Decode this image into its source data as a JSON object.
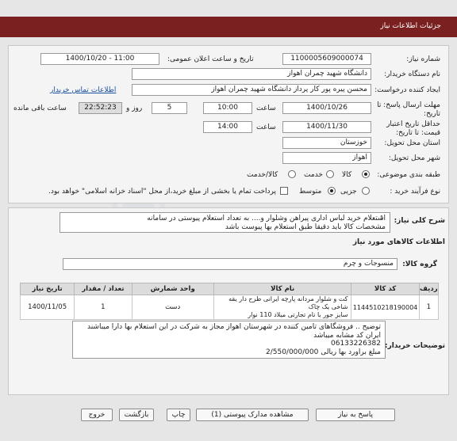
{
  "header": {
    "title": "جزئیات اطلاعات نیاز"
  },
  "form": {
    "need_number_label": "شماره نیاز:",
    "need_number": "1100005609000074",
    "announce_label": "تاریخ و ساعت اعلان عمومی:",
    "announce_value": "1400/10/20 - 11:00",
    "buyer_org_label": "نام دستگاه خریدار:",
    "buyer_org": "دانشگاه شهید چمران اهواز",
    "creator_label": "ایجاد کننده درخواست:",
    "creator": "محسن پیره پور کار پرداز دانشگاه شهید چمران اهواز",
    "contact_link": "اطلاعات تماس خریدار",
    "deadline_label": "مهلت ارسال پاسخ: تا تاریخ:",
    "deadline_date": "1400/10/26",
    "time_label": "ساعت",
    "deadline_time": "10:00",
    "days_value": "5",
    "days_label": "روز و",
    "remaining_time": "22:52:23",
    "remaining_label": "ساعت باقی مانده",
    "validity_label": "حداقل تاریخ اعتبار قیمت: تا تاریخ:",
    "validity_date": "1400/11/30",
    "validity_time": "14:00",
    "province_label": "استان محل تحویل:",
    "province": "خوزستان",
    "city_label": "شهر محل تحویل:",
    "city": "اهواز",
    "category_label": "طبقه بندی موضوعی:",
    "category_options": [
      "کالا",
      "خدمت",
      "کالا/خدمت"
    ],
    "process_label": "نوع فرآیند خرید :",
    "process_options": [
      "جزیی",
      "متوسط"
    ],
    "payment_note": "پرداخت تمام یا بخشی از مبلغ خرید،از محل \"اسناد خزانه اسلامی\" خواهد بود."
  },
  "details": {
    "general_label": "شرح کلی نیاز:",
    "general_text_1": "استعلام خرید لباس اداری پیراهن وشلوار و.... به تعداد استعلام پیوستی در سامانه",
    "general_text_2": "مشخصات کالا باید دقیقا طبق استعلام بها پیوست باشد",
    "goods_info_title": "اطلاعات کالاهای مورد نیاز",
    "goods_group_label": "گروه کالا:",
    "goods_group": "منسوجات و چرم",
    "table_headers": [
      "ردیف",
      "کد کالا",
      "نام کالا",
      "واحد شمارش",
      "تعداد / مقدار",
      "تاریخ نیاز"
    ],
    "rows": [
      {
        "row": "1",
        "code": "1144510218190004",
        "name_1": "کت و شلوار مردانه پارچه ایرانی طرح دار یقه شاخی یک چاک",
        "name_2": "سایز جور با نام تجارتی میلاد 110 نوار",
        "unit": "دست",
        "qty": "1",
        "date": "1400/11/05"
      }
    ],
    "buyer_notes_label": "توضیحات خریدار:",
    "notes_line_1": "توضیح .. فروشگاهای تامین کننده در شهرستان اهواز مجاز به شرکت در این استعلام بها دارا میباشند",
    "notes_line_2": "ایران کد مشابه میباشد",
    "notes_line_3": "06133226382",
    "notes_line_4": "مبلغ براورد بها  ریالی  2/550/000/000"
  },
  "buttons": {
    "reply": "پاسخ به نیاز",
    "view_docs": "مشاهده مدارک پیوستی (1)",
    "print": "چاپ",
    "back": "بازگشت",
    "exit": "خروج"
  },
  "colors": {
    "title_bar": "#7a2020",
    "link": "#1a4fa0"
  }
}
